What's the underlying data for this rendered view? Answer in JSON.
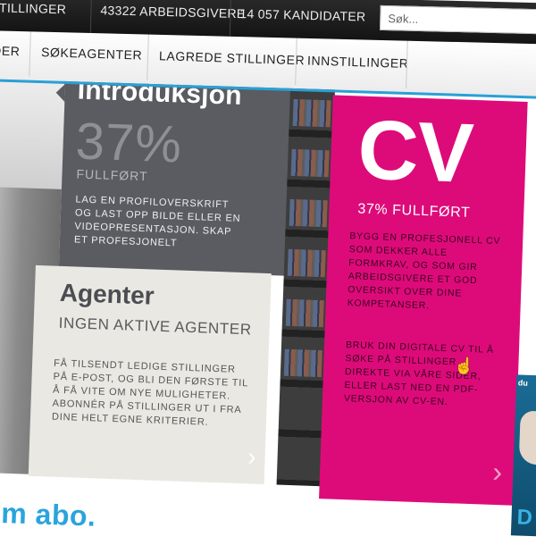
{
  "topbar": {
    "partial_left": "STILLINGER",
    "employers": "43322 ARBEIDSGIVERE",
    "candidates": "14 057 KANDIDATER",
    "search_placeholder": "Søk..."
  },
  "nav": {
    "partial_left": "DER",
    "items": [
      "SØKEAGENTER",
      "LAGREDE STILLINGER",
      "INNSTILLINGER"
    ]
  },
  "intro": {
    "title": "Introduksjon",
    "percent": "37%",
    "status": "FULLFØRT",
    "text": "Lag en profiloverskrift og last opp bilde eller en videopresentasjon. Skap et profesjonelt"
  },
  "agent": {
    "title": "Agenter",
    "subtitle": "INGEN AKTIVE AGENTER",
    "text": "Få tilsendt ledige stillinger på e-post, og bli den første til å få vite om nye muligheter. Abonnér på stillinger ut i fra dine helt egne kriterier."
  },
  "cv": {
    "title": "CV",
    "percent_status": "37% FULLFØRT",
    "text1": "Bygg en profesjonell CV som dekker alle formkrav, og som gir arbeidsgivere et god oversikt over dine kompetanser.",
    "text2": "Bruk din digitale CV til å søke på stillinger direkte via våre sider, eller last ned en PDF-versjon av CV-en."
  },
  "right_photo": {
    "tag": "du",
    "letter": "D"
  },
  "bottom_text": "m abo.",
  "icons": {
    "chevron": "›",
    "left_chevron": "›",
    "cursor": "☝"
  },
  "colors": {
    "accent": "#dd0b7a",
    "blue": "#29a0d6",
    "dark": "#5a5c62"
  }
}
